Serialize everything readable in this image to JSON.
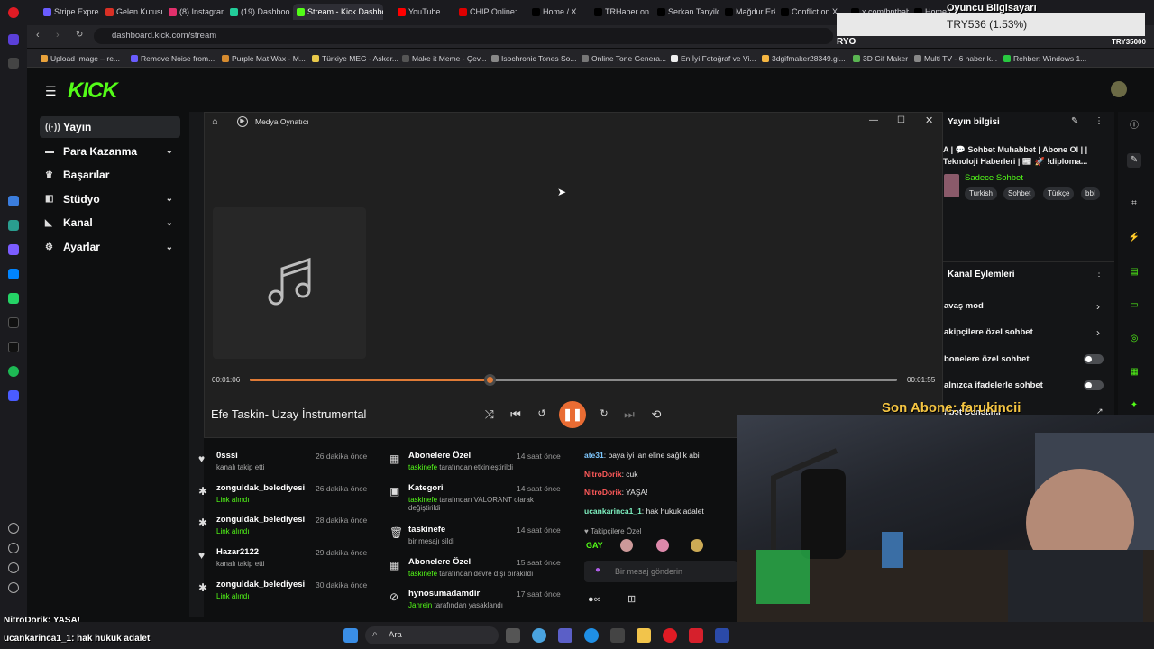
{
  "browser": {
    "tabs": [
      {
        "label": "Stripe Express",
        "color": "#6a5cff"
      },
      {
        "label": "Gelen Kutusu",
        "color": "#d93025"
      },
      {
        "label": "(8) Instagram",
        "color": "#e1306c"
      },
      {
        "label": "(19) Dashboo",
        "color": "#2c9"
      },
      {
        "label": "Stream - Kick Dashboa",
        "color": "#53fc18"
      },
      {
        "label": "YouTube",
        "color": "#ff0000"
      },
      {
        "label": "CHIP Online:",
        "color": "#d00"
      },
      {
        "label": "Home / X",
        "color": "#000"
      },
      {
        "label": "TRHaber on X",
        "color": "#000"
      },
      {
        "label": "Serkan Tanyild",
        "color": "#000"
      },
      {
        "label": "Mağdur Erkek",
        "color": "#000"
      },
      {
        "label": "Conflict on X",
        "color": "#000"
      },
      {
        "label": "x.com/bpthaber",
        "color": "#000"
      },
      {
        "label": "Home / X",
        "color": "#000"
      }
    ],
    "url": "dashboard.kick.com/stream",
    "bookmarks": [
      "Upload Image – re...",
      "Remove Noise from...",
      "Purple Mat Wax - M...",
      "Türkiye MEG - Asker...",
      "Make it Meme - Çev...",
      "Isochronic Tones So...",
      "Online Tone Genera...",
      "En İyi Fotoğraf ve Vi...",
      "3dgifmaker28349.gi...",
      "3D Gif Maker",
      "Multi TV - 6 haber k...",
      "Rehber: Windows 1..."
    ]
  },
  "overlay": {
    "donation_title": "Oyuncu Bilgisayarı",
    "donation_amount": "TRY536 (1.53%)",
    "ryo": "RYO",
    "try_goal": "TRY35000",
    "son_abone": "Son Abone: farukincii",
    "chat_line1_user": "NitroDorik",
    "chat_line1_msg": ": YAŞA!",
    "chat_line2_user": "ucankarinca1_1",
    "chat_line2_msg": ": hak hukuk adalet"
  },
  "kick": {
    "logo": "KICK",
    "nav": [
      {
        "label": "Yayın",
        "icon": "broadcast-icon",
        "expandable": false
      },
      {
        "label": "Para Kazanma",
        "icon": "money-icon",
        "expandable": true
      },
      {
        "label": "Başarılar",
        "icon": "trophy-icon",
        "expandable": false
      },
      {
        "label": "Stüdyo",
        "icon": "studio-icon",
        "expandable": true
      },
      {
        "label": "Kanal",
        "icon": "channel-icon",
        "expandable": true
      },
      {
        "label": "Ayarlar",
        "icon": "settings-icon",
        "expandable": true
      }
    ],
    "stream_info": {
      "heading": "Yayın bilgisi",
      "title": "A | 💬 Sohbet Muhabbet | Abone Ol | | Teknoloji Haberleri | 📰 🚀 !diploma...",
      "category": "Sadece Sohbet",
      "tags": [
        "Turkish",
        "Sohbet",
        "Türkçe",
        "bbl"
      ]
    },
    "channel_actions": {
      "heading": "Kanal Eylemleri",
      "items": [
        {
          "label": "avaş mod",
          "control": "arrow"
        },
        {
          "label": "akipçilere özel sohbet",
          "control": "arrow"
        },
        {
          "label": "bonelere özel sohbet",
          "control": "toggle"
        },
        {
          "label": "alnızca ifadelerle sohbet",
          "control": "toggle"
        },
        {
          "label": "hbet Denetimi",
          "control": "link"
        }
      ]
    },
    "activity": [
      {
        "name": "0sssi",
        "sub": "kanalı takip etti",
        "time": "26 dakika önce",
        "icon": "heart-icon"
      },
      {
        "name": "zonguldak_belediyesi",
        "sub": "Link alındı",
        "time": "26 dakika önce",
        "icon": "reward-icon"
      },
      {
        "name": "zonguldak_belediyesi",
        "sub": "Link alındı",
        "time": "28 dakika önce",
        "icon": "reward-icon"
      },
      {
        "name": "Hazar2122",
        "sub": "kanalı takip etti",
        "time": "29 dakika önce",
        "icon": "heart-icon"
      },
      {
        "name": "zonguldak_belediyesi",
        "sub": "Link alındı",
        "time": "30 dakika önce",
        "icon": "reward-icon"
      }
    ],
    "moderation": [
      {
        "title": "Abonelere Özel",
        "actor": "taskinefe",
        "sub": "tarafından etkinleştirildi",
        "time": "14 saat önce",
        "icon": "gift-icon"
      },
      {
        "title": "Kategori",
        "actor": "taskinefe",
        "sub": "tarafından VALORANT olarak değiştirildi",
        "time": "14 saat önce",
        "icon": "category-icon"
      },
      {
        "title": "taskinefe",
        "actor": "",
        "sub": "bir mesajı sildi",
        "time": "14 saat önce",
        "icon": "trash-icon"
      },
      {
        "title": "Abonelere Özel",
        "actor": "taskinefe",
        "sub": "tarafından devre dışı bırakıldı",
        "time": "15 saat önce",
        "icon": "gift-icon"
      },
      {
        "title": "hynosumadamdir",
        "actor": "Jahrein",
        "sub": "tarafından yasaklandı",
        "time": "17 saat önce",
        "icon": "ban-icon"
      }
    ],
    "chat": [
      {
        "user": "ate31",
        "msg": ": baya iyi lan eline sağlık abi",
        "color": "#7ec8ff"
      },
      {
        "user": "NitroDorik",
        "msg": ": cuk",
        "color": "#ff5a5a"
      },
      {
        "user": "NitroDorik",
        "msg": ": YAŞA!",
        "color": "#ff5a5a"
      },
      {
        "user": "ucankarinca1_1",
        "msg": ": hak hukuk adalet",
        "color": "#7ef0c0"
      }
    ],
    "chat_followers_label": "Takipçilere Özel",
    "chat_placeholder": "Bir mesaj gönderin"
  },
  "media_player": {
    "window_title": "Medya Oynatıcı",
    "track_title": "Efe Taskin- Uzay İnstrumental",
    "elapsed": "00:01:06",
    "duration": "00:01:55",
    "progress": 0.37
  },
  "taskbar": {
    "search_label": "Ara"
  }
}
